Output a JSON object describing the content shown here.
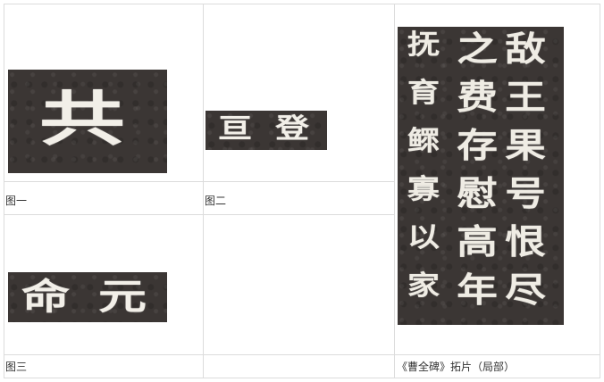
{
  "cells": {
    "fig1": {
      "caption": "图一",
      "glyphs": "共"
    },
    "fig2": {
      "caption": "图二",
      "glyphs": [
        "亘",
        "登"
      ]
    },
    "fig3": {
      "caption": "图三",
      "glyphs": [
        "命",
        "元"
      ]
    },
    "stele": {
      "caption": "《曹全碑》拓片（局部）",
      "columns": [
        [
          "敌",
          "王",
          "果",
          "号",
          "恨",
          "尽"
        ],
        [
          "之",
          "费",
          "存",
          "慰",
          "高",
          "年"
        ],
        [
          "抚",
          "育",
          "鳏",
          "寡",
          "以",
          "家"
        ]
      ]
    }
  },
  "colors": {
    "rubbing_background": "#3b3634",
    "glyph_color": "#f2efe8",
    "grid_line": "#dcdcdc"
  }
}
